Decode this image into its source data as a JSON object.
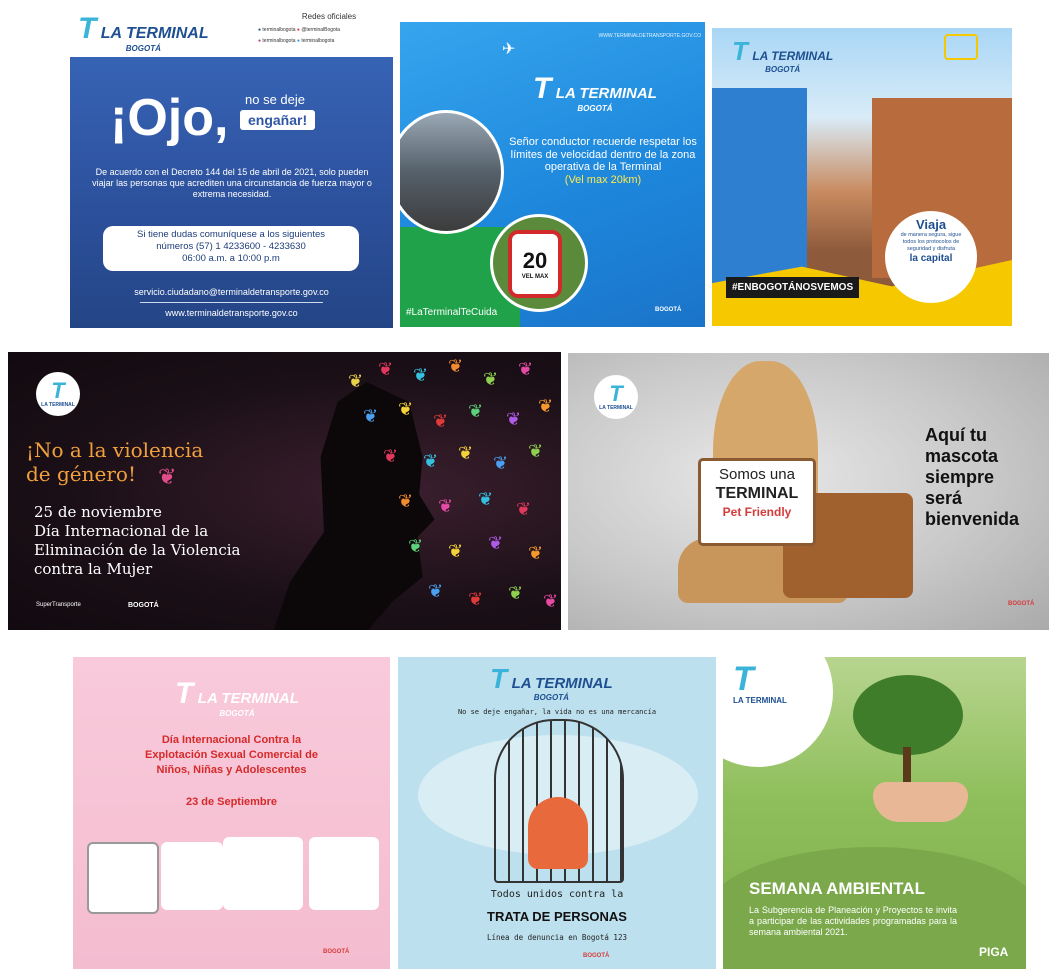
{
  "brand": {
    "name": "LA TERMINAL",
    "city": "BOGOTÁ"
  },
  "tile1": {
    "header_title": "Redes oficiales",
    "social": [
      "terminalbogota",
      "@terminalBogota",
      "terminalbogota",
      "terminalbogota"
    ],
    "headline_big": "¡Ojo,",
    "headline_small": "no se deje",
    "headline_badge": "engañar!",
    "body": "De acuerdo con el Decreto 144 del 15 de abril de 2021, solo pueden viajar las personas que acrediten una circunstancia de fuerza mayor o extrema necesidad.",
    "contact_line1": "Si tiene dudas comuníquese a los siguientes",
    "contact_line2": "números (57) 1 4233600 - 4233630",
    "contact_line3": "06:00 a.m. a 10:00 p.m",
    "email": "servicio.ciudadano@terminaldetransporte.gov.co",
    "web": "www.terminaldetransporte.gov.co"
  },
  "tile2": {
    "url": "WWW.TERMINALDETRANSPORTE.GOV.CO",
    "message": "Señor conductor recuerde respetar los límites de velocidad dentro de la zona operativa de la Terminal",
    "highlight": "(Vel max 20km)",
    "speed": "20",
    "speed_sub": "VEL MAX",
    "hashtag": "#LaTerminalTeCuida",
    "footer": "BOGOTÁ"
  },
  "tile3": {
    "hashtag": "#ENBOGOTÁNOSVEMOS",
    "bubble_title": "Viaja",
    "bubble_body": "de manera segura, sigue todos los protocolos de seguridad y disfruta",
    "bubble_end": "la capital"
  },
  "tile4": {
    "title_line1": "¡No a la violencia",
    "title_line2": "de género!",
    "date": "25 de noviembre",
    "body_line1": "Día Internacional de la",
    "body_line2": "Eliminación de la Violencia",
    "body_line3": "contra la Mujer",
    "footer_left": "SuperTransporte",
    "footer_right": "BOGOTÁ"
  },
  "tile5": {
    "sign_line1": "Somos una",
    "sign_line2": "TERMINAL",
    "sign_line3": "Pet Friendly",
    "right_line1": "Aquí tu",
    "right_line2": "mascota",
    "right_line3": "siempre",
    "right_line4": "será",
    "right_line5": "bienvenida",
    "footer": "BOGOTÁ"
  },
  "tile6": {
    "title_line1": "Día Internacional Contra la",
    "title_line2": "Explotación Sexual Comercial de",
    "title_line3": "Niños, Niñas y Adolescentes",
    "date": "23 de Septiembre",
    "footer": "BOGOTÁ"
  },
  "tile7": {
    "top_text": "No se deje engañar, la vida no es una mercancía",
    "line1": "Todos unidos contra la",
    "line2": "TRATA DE PERSONAS",
    "line3": "Línea de denuncia en Bogotá 123",
    "footer": "BOGOTÁ"
  },
  "tile8": {
    "title": "SEMANA AMBIENTAL",
    "body": "La Subgerencia de Planeación y Proyectos te invita a participar de las actividades programadas para la semana ambiental 2021.",
    "badge": "PIGA"
  },
  "colors": {
    "tile1_bg": "#2f57a6",
    "tile2_bg": "#1e8fe0",
    "tile3_yellow": "#f5c800",
    "tile4_bg": "#1a0f16",
    "tile5_bg": "#bfbfbf",
    "tile6_bg": "#f6c4d6",
    "tile7_bg": "#bde0ee",
    "tile8_bg": "#7dac4a",
    "accent_pink": "#d62a6c",
    "accent_orange": "#f2a03d"
  }
}
